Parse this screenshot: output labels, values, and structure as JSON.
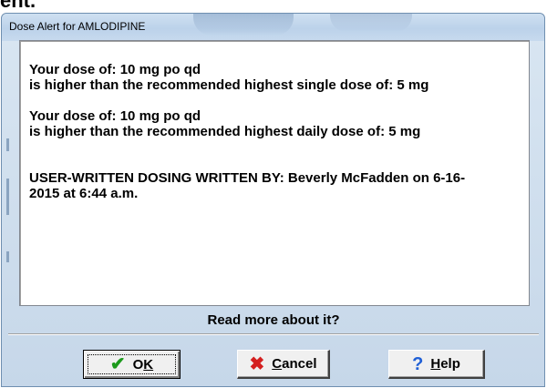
{
  "page_fragment": "ent.",
  "dialog": {
    "title": "Dose Alert for AMLODIPINE"
  },
  "message": {
    "lines": [
      "Your dose of: 10 mg po qd",
      "is higher than the recommended highest single dose of: 5 mg",
      "Your dose of: 10 mg po qd",
      "is higher than the recommended highest daily dose of: 5 mg",
      "USER-WRITTEN DOSING WRITTEN BY: Beverly McFadden on 6-16-",
      "2015 at 6:44 a.m."
    ]
  },
  "read_more_label": "Read more about it?",
  "buttons": {
    "ok": {
      "icon": "check-icon",
      "label_underlined": "K",
      "label_prefix": "O",
      "label_suffix": ""
    },
    "cancel": {
      "icon": "x-icon",
      "label_underlined": "C",
      "label_prefix": "",
      "label_suffix": "ancel"
    },
    "help": {
      "icon": "help-icon",
      "label_underlined": "H",
      "label_prefix": "",
      "label_suffix": "elp"
    }
  },
  "colors": {
    "ok_check": "#1c9a1c",
    "cancel_x": "#d42020",
    "help_question": "#1f5fd6"
  }
}
